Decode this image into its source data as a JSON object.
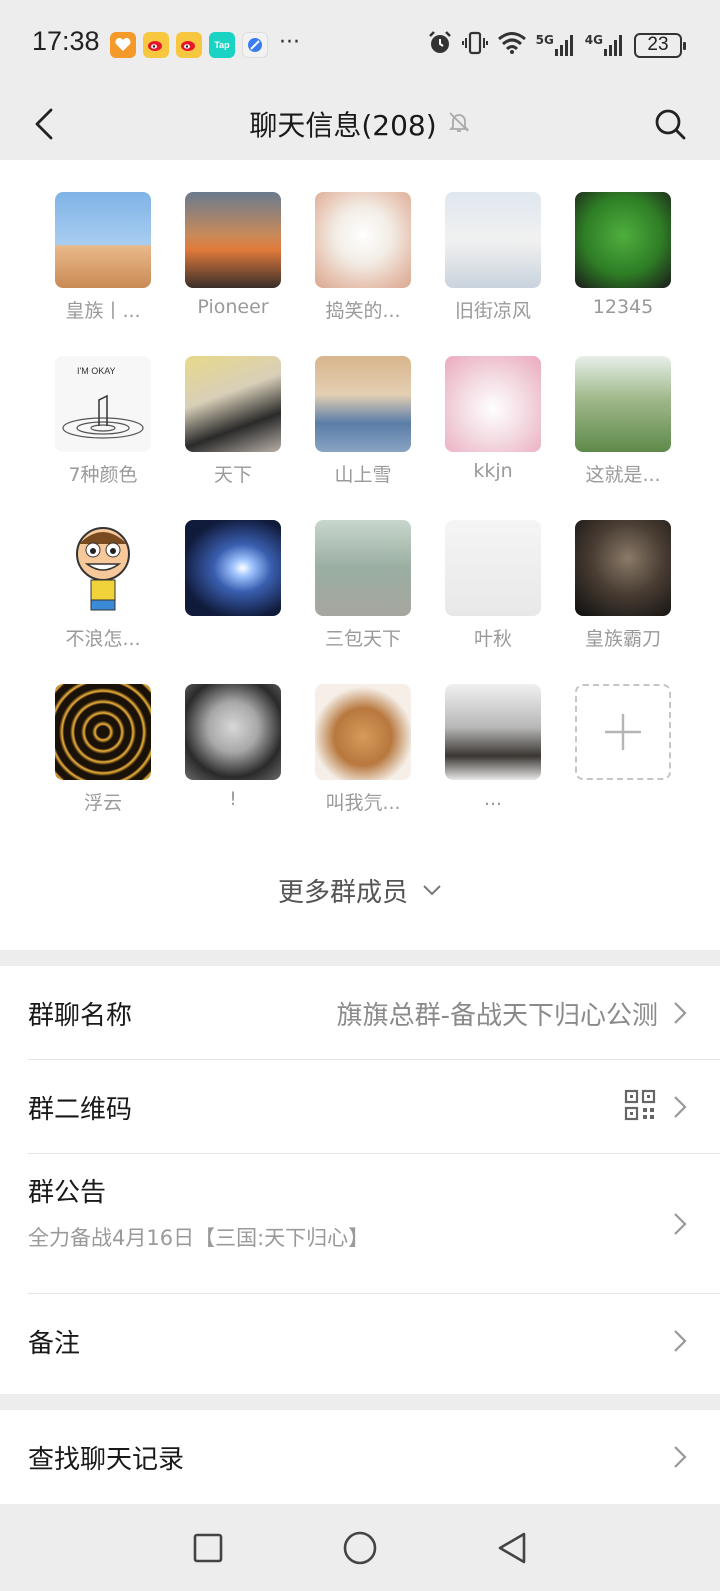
{
  "status_bar": {
    "time": "17:38",
    "notification_apps": [
      "app-icon-orange",
      "weibo-icon",
      "weibo-icon",
      "taptap-icon",
      "browser-icon"
    ],
    "taptap_label": "Tap",
    "more": "···",
    "network_5g": "5G",
    "network_4g": "4G",
    "battery": "23"
  },
  "title_bar": {
    "title": "聊天信息(208)",
    "muted": true
  },
  "members": [
    {
      "name": "皇族丨...",
      "avatar": "avatar-cartoon-man"
    },
    {
      "name": "Pioneer",
      "avatar": "avatar-sunset-silhouette"
    },
    {
      "name": "捣笑的...",
      "avatar": "avatar-white-puppy"
    },
    {
      "name": "旧街凉风",
      "avatar": "avatar-anime-boy"
    },
    {
      "name": "12345",
      "avatar": "avatar-green-mask"
    },
    {
      "name": "7种颜色",
      "avatar": "avatar-im-okay-sketch"
    },
    {
      "name": "天下",
      "avatar": "avatar-person-on-chair"
    },
    {
      "name": "山上雪",
      "avatar": "avatar-baby-denim"
    },
    {
      "name": "kkjn",
      "avatar": "avatar-pink-bear"
    },
    {
      "name": "这就是...",
      "avatar": "avatar-man-in-field"
    },
    {
      "name": "不浪怎...",
      "avatar": "avatar-cartoon-kid"
    },
    {
      "name": "",
      "avatar": "avatar-galaxy"
    },
    {
      "name": "三包天下",
      "avatar": "avatar-kids-street"
    },
    {
      "name": "叶秋",
      "avatar": "avatar-sketch-girl"
    },
    {
      "name": "皇族霸刀",
      "avatar": "avatar-man-sweater"
    },
    {
      "name": "浮云",
      "avatar": "avatar-golden-rings"
    },
    {
      "name": "!",
      "avatar": "avatar-dark-boy"
    },
    {
      "name": "叫我氕...",
      "avatar": "avatar-cat-curls"
    },
    {
      "name": "...",
      "avatar": "avatar-blur-silhouette"
    }
  ],
  "more_members_label": "更多群成员",
  "settings": {
    "group_name_label": "群聊名称",
    "group_name_value": "旗旗总群-备战天下归心公测",
    "qr_label": "群二维码",
    "notice_label": "群公告",
    "notice_text": "全力备战4月16日【三国:天下归心】",
    "remark_label": "备注",
    "search_history_label": "查找聊天记录"
  },
  "colors": {
    "background": "#ededed",
    "panel": "#ffffff",
    "muted_text": "#9a9a9a"
  }
}
